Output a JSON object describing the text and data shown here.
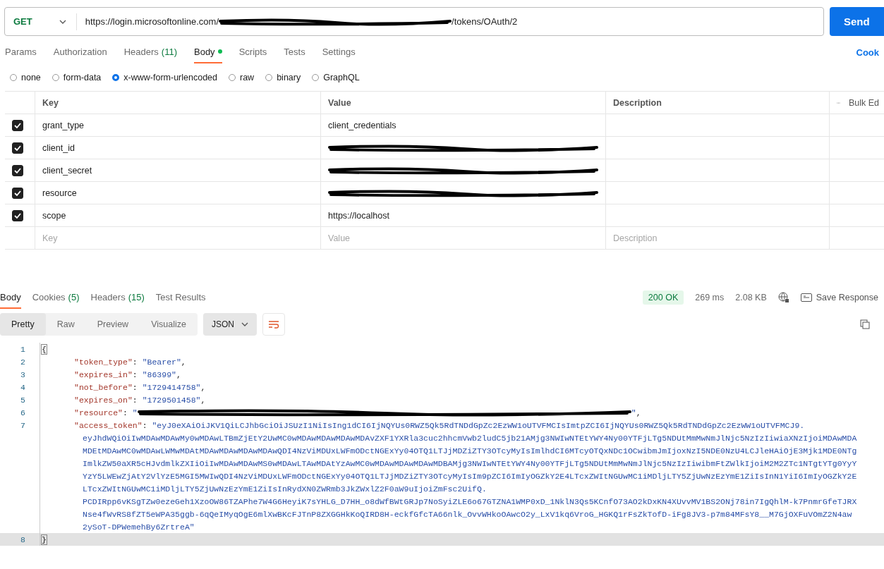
{
  "request": {
    "method": "GET",
    "url": [
      {
        "kind": "text",
        "text": "https://login.microsoftonline.com/"
      },
      {
        "kind": "redaction"
      },
      {
        "kind": "text",
        "text": "/tokens/OAuth/2"
      }
    ],
    "send": "Send"
  },
  "request_tabs": [
    {
      "label": "Params",
      "selected": false,
      "modified": false
    },
    {
      "label": "Authorization",
      "selected": false,
      "modified": false
    },
    {
      "label": "Headers",
      "count": "(11)",
      "selected": false,
      "modified": false
    },
    {
      "label": "Body",
      "selected": true,
      "modified": true
    },
    {
      "label": "Scripts",
      "selected": false,
      "modified": false
    },
    {
      "label": "Tests",
      "selected": false,
      "modified": false
    },
    {
      "label": "Settings",
      "selected": false,
      "modified": false
    }
  ],
  "cookies_link": "Cook",
  "body_types": [
    {
      "label": "none",
      "selected": false
    },
    {
      "label": "form-data",
      "selected": false
    },
    {
      "label": "x-www-form-urlencoded",
      "selected": true
    },
    {
      "label": "raw",
      "selected": false
    },
    {
      "label": "binary",
      "selected": false
    },
    {
      "label": "GraphQL",
      "selected": false
    }
  ],
  "table": {
    "columns": [
      "Key",
      "Value",
      "Description"
    ],
    "bulk_edit": "Bulk Ed",
    "rows": [
      {
        "checked": true,
        "key": "grant_type",
        "value": [
          {
            "kind": "text",
            "text": "client_credentials"
          }
        ]
      },
      {
        "checked": true,
        "key": "client_id",
        "value": [
          {
            "kind": "redaction"
          }
        ]
      },
      {
        "checked": true,
        "key": "client_secret",
        "value": [
          {
            "kind": "redaction"
          }
        ]
      },
      {
        "checked": true,
        "key": "resource",
        "value": [
          {
            "kind": "redaction"
          }
        ]
      },
      {
        "checked": true,
        "key": "scope",
        "value": [
          {
            "kind": "text",
            "text": "https://localhost"
          }
        ]
      }
    ],
    "new_row": {
      "key_placeholder": "Key",
      "value_placeholder": "Value",
      "description_placeholder": "Description"
    }
  },
  "response": {
    "tabs": [
      {
        "label": "Body",
        "selected": true
      },
      {
        "label": "Cookies",
        "count": "(5)",
        "selected": false
      },
      {
        "label": "Headers",
        "count": "(15)",
        "selected": false
      },
      {
        "label": "Test Results",
        "selected": false
      }
    ],
    "status": "200 OK",
    "time": "269 ms",
    "size": "2.08 KB",
    "save": "Save Response",
    "views": [
      {
        "label": "Pretty",
        "selected": true
      },
      {
        "label": "Raw",
        "selected": false
      },
      {
        "label": "Preview",
        "selected": false
      },
      {
        "label": "Visualize",
        "selected": false
      }
    ],
    "format": "JSON",
    "lines": [
      {
        "number": "1",
        "current": false,
        "tokens": [
          {
            "kind": "bracket",
            "text": "{"
          }
        ]
      },
      {
        "number": "2",
        "current": false,
        "tokens": [
          {
            "kind": "key",
            "text": "\"token_type\""
          },
          {
            "kind": "punct",
            "text": ": "
          },
          {
            "kind": "string",
            "text": "\"Bearer\""
          },
          {
            "kind": "punct",
            "text": ","
          }
        ]
      },
      {
        "number": "3",
        "current": false,
        "tokens": [
          {
            "kind": "key",
            "text": "\"expires_in\""
          },
          {
            "kind": "punct",
            "text": ": "
          },
          {
            "kind": "string",
            "text": "\"86399\""
          },
          {
            "kind": "punct",
            "text": ","
          }
        ]
      },
      {
        "number": "4",
        "current": false,
        "tokens": [
          {
            "kind": "key",
            "text": "\"not_before\""
          },
          {
            "kind": "punct",
            "text": ": "
          },
          {
            "kind": "string",
            "text": "\"1729414758\""
          },
          {
            "kind": "punct",
            "text": ","
          }
        ]
      },
      {
        "number": "5",
        "current": false,
        "tokens": [
          {
            "kind": "key",
            "text": "\"expires_on\""
          },
          {
            "kind": "punct",
            "text": ": "
          },
          {
            "kind": "string",
            "text": "\"1729501458\""
          },
          {
            "kind": "punct",
            "text": ","
          }
        ]
      },
      {
        "number": "6",
        "current": false,
        "tokens": [
          {
            "kind": "key",
            "text": "\"resource\""
          },
          {
            "kind": "punct",
            "text": ": "
          },
          {
            "kind": "string",
            "text": "\""
          },
          {
            "kind": "redaction"
          },
          {
            "kind": "string",
            "text": "\""
          },
          {
            "kind": "punct",
            "text": ","
          }
        ]
      },
      {
        "number": "7",
        "current": false,
        "tokens": [
          {
            "kind": "key",
            "text": "\"access_token\""
          },
          {
            "kind": "punct",
            "text": ": "
          },
          {
            "kind": "string",
            "text": "\"eyJ0eXAiOiJKV1QiLCJhbGciOiJSUzI1NiIsIng1dCI6IjNQYUs0RWZ5Qk5RdTNDdGpZc2EzWW1oUTVFMCIsImtpZCI6IjNQYUs0RWZ5Qk5RdTNDdGpZc2EzWW1oUTVFMCJ9."
          }
        ],
        "continuation": [
          "eyJhdWQiOiIwMDAwMDAwMy0wMDAwLTBmZjEtY2UwMC0wMDAwMDAwMDAwMDAvZXF1YXRla3cuc2hhcmVwb2ludC5jb21AMjg3NWIwNTEtYWY4Ny00YTFjLTg5NDUtMmMwNmJlNjc5NzIzIiwiaXNzIjoiMDAwMDA",
          "MDEtMDAwMC0wMDAwLWMwMDAtMDAwMDAwMDAwMDAwQDI4NzViMDUxLWFmODctNGExYy04OTQ1LTJjMDZiZTY3OTcyMyIsImlhdCI6MTcyOTQxNDc1OCwibmJmIjoxNzI5NDE0NzU4LCJleHAiOjE3Mjk1MDE0NTg",
          "ImlkZW50aXR5cHJvdmlkZXIiOiIwMDAwMDAwMS0wMDAwLTAwMDAtYzAwMC0wMDAwMDAwMDAwMDBAMjg3NWIwNTEtYWY4Ny00YTFjLTg5NDUtMmMwNmJlNjc5NzIzIiwibmFtZWlkIjoiM2M2ZTc1NTgtYTg0YyY",
          "YzY5LWEwZjAtY2VlYzE5MGI5MWIwQDI4NzViMDUxLWFmODctNGExYy04OTQ1LTJjMDZiZTY3OTcyMyIsIm9pZCI6ImIyOGZkY2E4LTcxZWItNGUwMC1iMDljLTY5ZjUwNzEzYmE1ZiIsInN1YiI6ImIyOGZkY2E",
          "LTcxZWItNGUwMC1iMDljLTY5ZjUwNzEzYmE1ZiIsInRydXN0ZWRmb3JkZWxlZ2F0aW9uIjoiZmFsc2UifQ.",
          "PCDIRpp6vKSgTZw0ezeGeh1XzoOW86TZAPhe7W4G6HeyiK7sYHLG_D7HH_o8dWfBWtGRJp7NoSyiZLE6o67GTZNA1WMP0xD_1NklN3Qs5KCnfO73AO2kDxKN4XUvvMV1BS2ONj78in7IgQhlM-k7PnmrGfeTJRX",
          "Nse4fWvRS8fZT5eWPA35ggb-6qQeIMyqOgE6mlXwBKcFJTnP8ZXGGHkKoQIRD8H-eckfGfcTA66nlk_OvvWHkoOAwcO2y_LxV1kq6VroG_HGKQ1rFsZkTofD-iFg8JV3-p7m84MFsY8__M7GjOXFuVOmZ2N4aw",
          "2ySoT-DPWemehBy6ZrtreA\""
        ]
      },
      {
        "number": "8",
        "current": true,
        "tokens": [
          {
            "kind": "bracket",
            "text": "}"
          }
        ]
      }
    ]
  }
}
